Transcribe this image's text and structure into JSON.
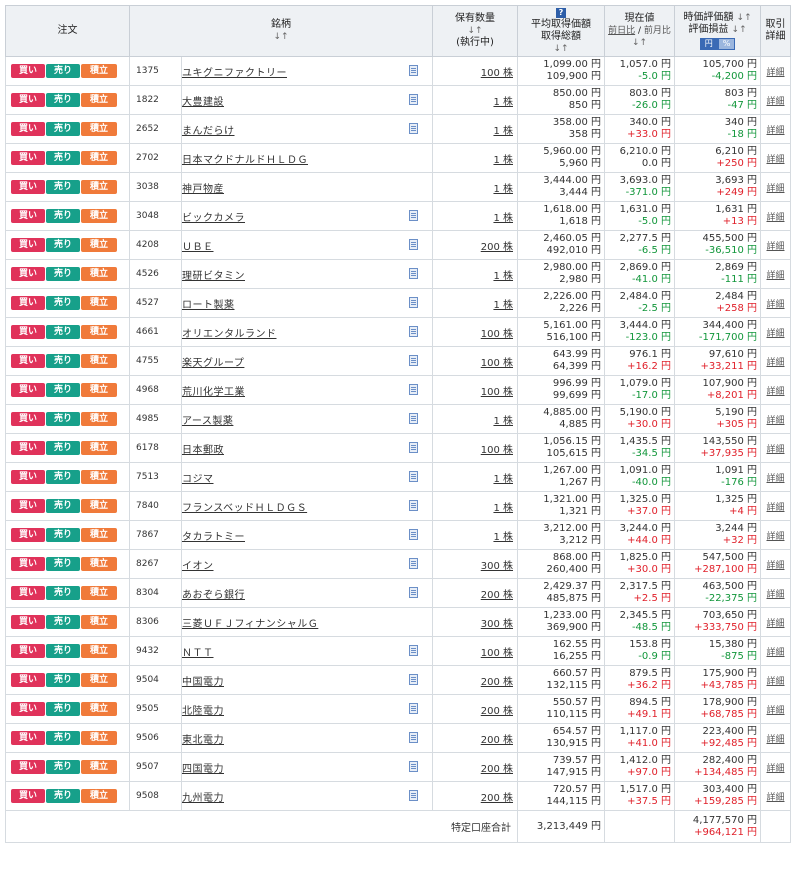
{
  "headers": {
    "order": "注文",
    "name": "銘柄",
    "name_sort": "↓↑",
    "qty_line1": "保有数量",
    "qty_sort": "↓↑",
    "qty_line2": "(執行中)",
    "avg_line1": "平均取得価額",
    "avg_line2": "取得総額",
    "avg_sort": "↓↑",
    "cur_line1": "現在値",
    "cur_prev_day": "前日比",
    "cur_sep": " / ",
    "cur_prev_month": "前月比",
    "cur_sort": "↓↑",
    "val_line1": "時価評価額",
    "val_line2": "評価損益",
    "val_sort": "↓↑",
    "unit_yen": "円",
    "unit_pct": "%",
    "detail_line1": "取引",
    "detail_line2": "詳細"
  },
  "buttons": {
    "buy": "買い",
    "sell": "売り",
    "accumulate": "積立"
  },
  "detail_label": "詳細",
  "rows": [
    {
      "code": "1375",
      "name": "ユキグニファクトリー",
      "doc": true,
      "qty": "100 株",
      "avg_price": "1,099.00 円",
      "avg_total": "109,900 円",
      "cur_price": "1,057.0 円",
      "cur_change": "-5.0 円",
      "cur_sign": "neg",
      "value": "105,700 円",
      "pl": "-4,200 円",
      "pl_sign": "neg"
    },
    {
      "code": "1822",
      "name": "大豊建設",
      "doc": true,
      "qty": "1 株",
      "avg_price": "850.00 円",
      "avg_total": "850 円",
      "cur_price": "803.0 円",
      "cur_change": "-26.0 円",
      "cur_sign": "neg",
      "value": "803 円",
      "pl": "-47 円",
      "pl_sign": "neg"
    },
    {
      "code": "2652",
      "name": "まんだらけ",
      "doc": true,
      "qty": "1 株",
      "avg_price": "358.00 円",
      "avg_total": "358 円",
      "cur_price": "340.0 円",
      "cur_change": "+33.0 円",
      "cur_sign": "pos",
      "value": "340 円",
      "pl": "-18 円",
      "pl_sign": "neg"
    },
    {
      "code": "2702",
      "name": "日本マクドナルドＨＬＤＧ",
      "doc": false,
      "qty": "1 株",
      "avg_price": "5,960.00 円",
      "avg_total": "5,960 円",
      "cur_price": "6,210.0 円",
      "cur_change": "0.0 円",
      "cur_sign": "zero",
      "value": "6,210 円",
      "pl": "+250 円",
      "pl_sign": "pos"
    },
    {
      "code": "3038",
      "name": "神戸物産",
      "doc": false,
      "qty": "1 株",
      "avg_price": "3,444.00 円",
      "avg_total": "3,444 円",
      "cur_price": "3,693.0 円",
      "cur_change": "-371.0 円",
      "cur_sign": "neg",
      "value": "3,693 円",
      "pl": "+249 円",
      "pl_sign": "pos"
    },
    {
      "code": "3048",
      "name": "ビックカメラ",
      "doc": true,
      "qty": "1 株",
      "avg_price": "1,618.00 円",
      "avg_total": "1,618 円",
      "cur_price": "1,631.0 円",
      "cur_change": "-5.0 円",
      "cur_sign": "neg",
      "value": "1,631 円",
      "pl": "+13 円",
      "pl_sign": "pos"
    },
    {
      "code": "4208",
      "name": "ＵＢＥ",
      "doc": true,
      "qty": "200 株",
      "avg_price": "2,460.05 円",
      "avg_total": "492,010 円",
      "cur_price": "2,277.5 円",
      "cur_change": "-6.5 円",
      "cur_sign": "neg",
      "value": "455,500 円",
      "pl": "-36,510 円",
      "pl_sign": "neg"
    },
    {
      "code": "4526",
      "name": "理研ビタミン",
      "doc": true,
      "qty": "1 株",
      "avg_price": "2,980.00 円",
      "avg_total": "2,980 円",
      "cur_price": "2,869.0 円",
      "cur_change": "-41.0 円",
      "cur_sign": "neg",
      "value": "2,869 円",
      "pl": "-111 円",
      "pl_sign": "neg"
    },
    {
      "code": "4527",
      "name": "ロート製薬",
      "doc": true,
      "qty": "1 株",
      "avg_price": "2,226.00 円",
      "avg_total": "2,226 円",
      "cur_price": "2,484.0 円",
      "cur_change": "-2.5 円",
      "cur_sign": "neg",
      "value": "2,484 円",
      "pl": "+258 円",
      "pl_sign": "pos"
    },
    {
      "code": "4661",
      "name": "オリエンタルランド",
      "doc": true,
      "qty": "100 株",
      "avg_price": "5,161.00 円",
      "avg_total": "516,100 円",
      "cur_price": "3,444.0 円",
      "cur_change": "-123.0 円",
      "cur_sign": "neg",
      "value": "344,400 円",
      "pl": "-171,700 円",
      "pl_sign": "neg"
    },
    {
      "code": "4755",
      "name": "楽天グループ",
      "doc": true,
      "qty": "100 株",
      "avg_price": "643.99 円",
      "avg_total": "64,399 円",
      "cur_price": "976.1 円",
      "cur_change": "+16.2 円",
      "cur_sign": "pos",
      "value": "97,610 円",
      "pl": "+33,211 円",
      "pl_sign": "pos"
    },
    {
      "code": "4968",
      "name": "荒川化学工業",
      "doc": true,
      "qty": "100 株",
      "avg_price": "996.99 円",
      "avg_total": "99,699 円",
      "cur_price": "1,079.0 円",
      "cur_change": "-17.0 円",
      "cur_sign": "neg",
      "value": "107,900 円",
      "pl": "+8,201 円",
      "pl_sign": "pos"
    },
    {
      "code": "4985",
      "name": "アース製薬",
      "doc": true,
      "qty": "1 株",
      "avg_price": "4,885.00 円",
      "avg_total": "4,885 円",
      "cur_price": "5,190.0 円",
      "cur_change": "+30.0 円",
      "cur_sign": "pos",
      "value": "5,190 円",
      "pl": "+305 円",
      "pl_sign": "pos"
    },
    {
      "code": "6178",
      "name": "日本郵政",
      "doc": true,
      "qty": "100 株",
      "avg_price": "1,056.15 円",
      "avg_total": "105,615 円",
      "cur_price": "1,435.5 円",
      "cur_change": "-34.5 円",
      "cur_sign": "neg",
      "value": "143,550 円",
      "pl": "+37,935 円",
      "pl_sign": "pos"
    },
    {
      "code": "7513",
      "name": "コジマ",
      "doc": true,
      "qty": "1 株",
      "avg_price": "1,267.00 円",
      "avg_total": "1,267 円",
      "cur_price": "1,091.0 円",
      "cur_change": "-40.0 円",
      "cur_sign": "neg",
      "value": "1,091 円",
      "pl": "-176 円",
      "pl_sign": "neg"
    },
    {
      "code": "7840",
      "name": "フランスベッドＨＬＤＧＳ",
      "doc": true,
      "qty": "1 株",
      "avg_price": "1,321.00 円",
      "avg_total": "1,321 円",
      "cur_price": "1,325.0 円",
      "cur_change": "+37.0 円",
      "cur_sign": "pos",
      "value": "1,325 円",
      "pl": "+4 円",
      "pl_sign": "pos"
    },
    {
      "code": "7867",
      "name": "タカラトミー",
      "doc": true,
      "qty": "1 株",
      "avg_price": "3,212.00 円",
      "avg_total": "3,212 円",
      "cur_price": "3,244.0 円",
      "cur_change": "+44.0 円",
      "cur_sign": "pos",
      "value": "3,244 円",
      "pl": "+32 円",
      "pl_sign": "pos"
    },
    {
      "code": "8267",
      "name": "イオン",
      "doc": true,
      "qty": "300 株",
      "avg_price": "868.00 円",
      "avg_total": "260,400 円",
      "cur_price": "1,825.0 円",
      "cur_change": "+30.0 円",
      "cur_sign": "pos",
      "value": "547,500 円",
      "pl": "+287,100 円",
      "pl_sign": "pos"
    },
    {
      "code": "8304",
      "name": "あおぞら銀行",
      "doc": true,
      "qty": "200 株",
      "avg_price": "2,429.37 円",
      "avg_total": "485,875 円",
      "cur_price": "2,317.5 円",
      "cur_change": "+2.5 円",
      "cur_sign": "pos",
      "value": "463,500 円",
      "pl": "-22,375 円",
      "pl_sign": "neg"
    },
    {
      "code": "8306",
      "name": "三菱ＵＦＪフィナンシャルＧ",
      "doc": false,
      "qty": "300 株",
      "avg_price": "1,233.00 円",
      "avg_total": "369,900 円",
      "cur_price": "2,345.5 円",
      "cur_change": "-48.5 円",
      "cur_sign": "neg",
      "value": "703,650 円",
      "pl": "+333,750 円",
      "pl_sign": "pos"
    },
    {
      "code": "9432",
      "name": "ＮＴＴ",
      "doc": true,
      "qty": "100 株",
      "avg_price": "162.55 円",
      "avg_total": "16,255 円",
      "cur_price": "153.8 円",
      "cur_change": "-0.9 円",
      "cur_sign": "neg",
      "value": "15,380 円",
      "pl": "-875 円",
      "pl_sign": "neg"
    },
    {
      "code": "9504",
      "name": "中国電力",
      "doc": true,
      "qty": "200 株",
      "avg_price": "660.57 円",
      "avg_total": "132,115 円",
      "cur_price": "879.5 円",
      "cur_change": "+36.2 円",
      "cur_sign": "pos",
      "value": "175,900 円",
      "pl": "+43,785 円",
      "pl_sign": "pos"
    },
    {
      "code": "9505",
      "name": "北陸電力",
      "doc": true,
      "qty": "200 株",
      "avg_price": "550.57 円",
      "avg_total": "110,115 円",
      "cur_price": "894.5 円",
      "cur_change": "+49.1 円",
      "cur_sign": "pos",
      "value": "178,900 円",
      "pl": "+68,785 円",
      "pl_sign": "pos"
    },
    {
      "code": "9506",
      "name": "東北電力",
      "doc": true,
      "qty": "200 株",
      "avg_price": "654.57 円",
      "avg_total": "130,915 円",
      "cur_price": "1,117.0 円",
      "cur_change": "+41.0 円",
      "cur_sign": "pos",
      "value": "223,400 円",
      "pl": "+92,485 円",
      "pl_sign": "pos"
    },
    {
      "code": "9507",
      "name": "四国電力",
      "doc": true,
      "qty": "200 株",
      "avg_price": "739.57 円",
      "avg_total": "147,915 円",
      "cur_price": "1,412.0 円",
      "cur_change": "+97.0 円",
      "cur_sign": "pos",
      "value": "282,400 円",
      "pl": "+134,485 円",
      "pl_sign": "pos"
    },
    {
      "code": "9508",
      "name": "九州電力",
      "doc": true,
      "qty": "200 株",
      "avg_price": "720.57 円",
      "avg_total": "144,115 円",
      "cur_price": "1,517.0 円",
      "cur_change": "+37.5 円",
      "cur_sign": "pos",
      "value": "303,400 円",
      "pl": "+159,285 円",
      "pl_sign": "pos"
    }
  ],
  "footer": {
    "label": "特定口座合計",
    "avg_total": "3,213,449 円",
    "value": "4,177,570 円",
    "pl": "+964,121 円",
    "pl_sign": "pos"
  },
  "colors": {
    "buy": "#e0325a",
    "sell": "#17a08a",
    "accumulate": "#f07a3a",
    "positive": "#e0202a",
    "negative": "#11963a",
    "header_bg": "#eef1f4"
  }
}
